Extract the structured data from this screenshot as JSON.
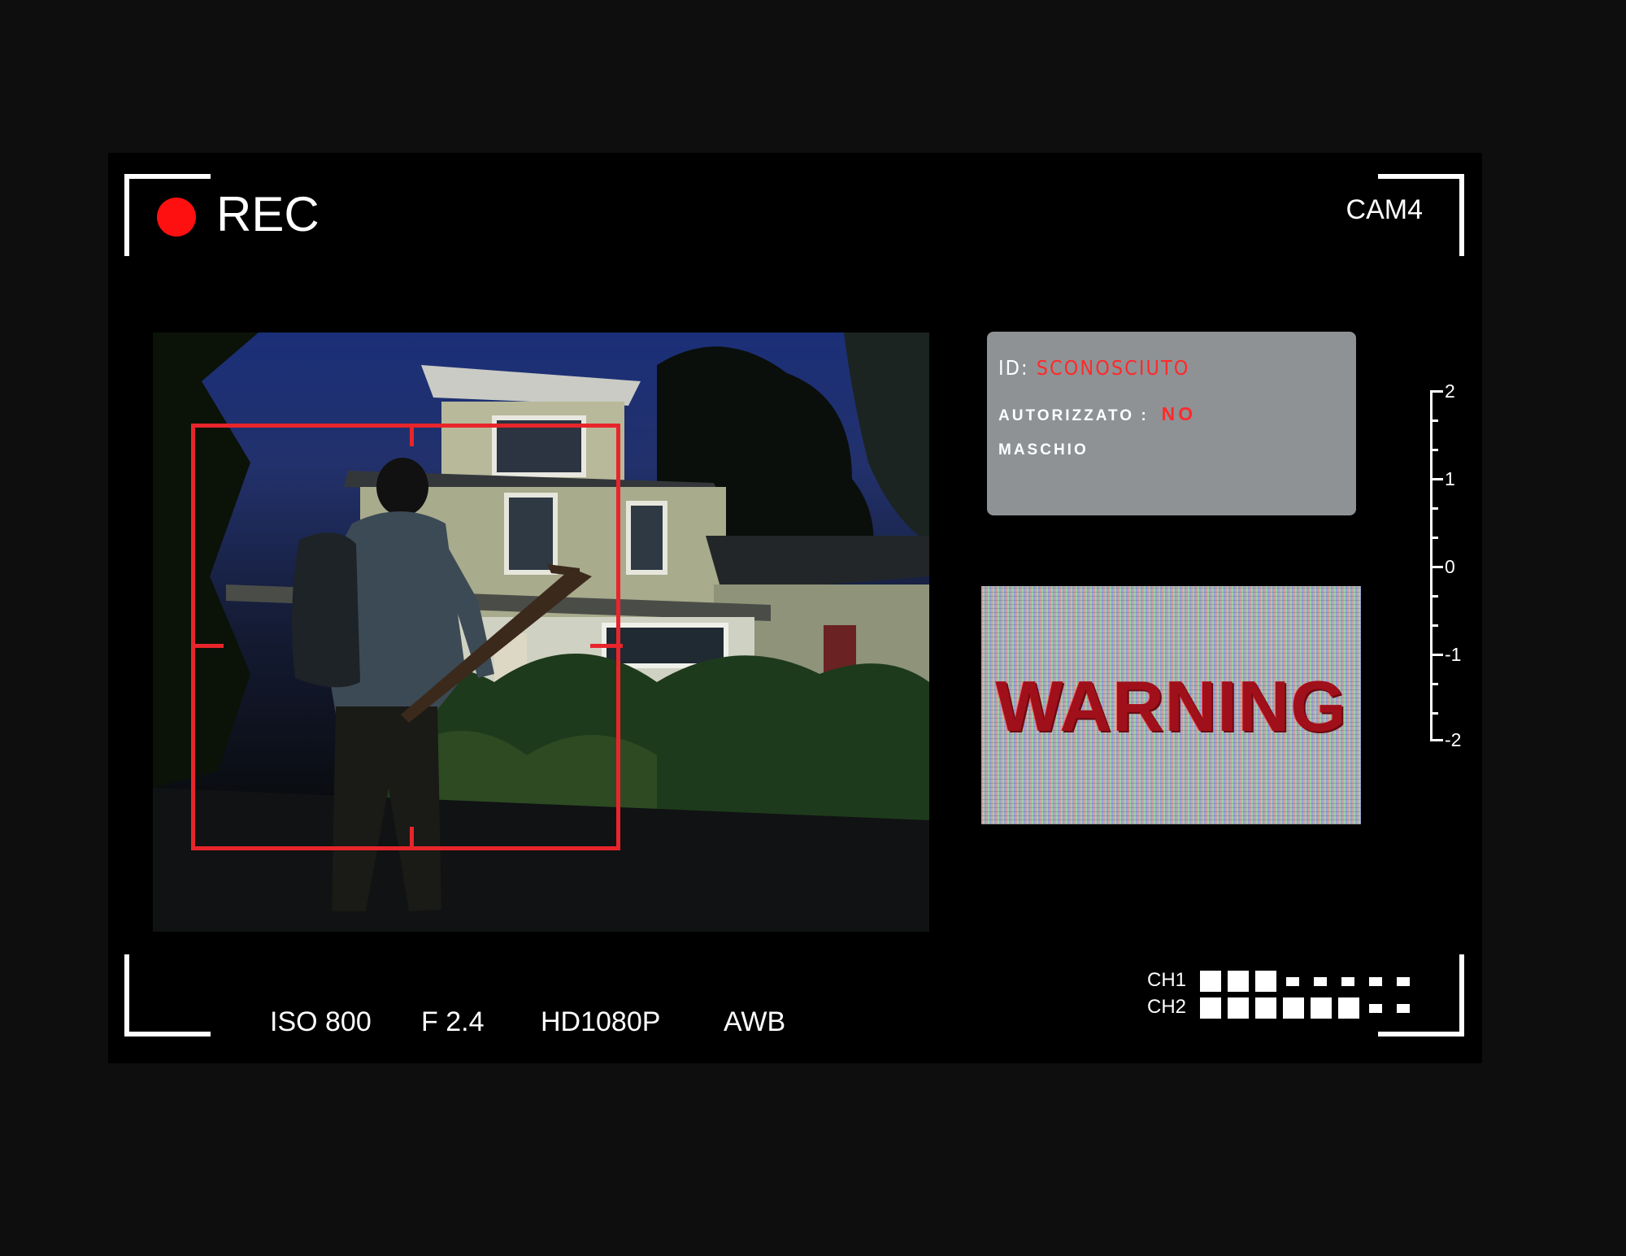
{
  "hud": {
    "rec_label": "REC",
    "camera_label": "CAM4",
    "rec_color": "#ff1010",
    "accent_color": "#e8252b"
  },
  "subject_card": {
    "id_label": "ID:",
    "id_value": "SCONOSCIUTO",
    "authorized_label": "AUTORIZZATO :",
    "authorized_value": "NO",
    "gender": "MASCHIO"
  },
  "warning": {
    "text": "WARNING"
  },
  "scale": {
    "labels": [
      "2",
      "1",
      "0",
      "-1",
      "-2"
    ]
  },
  "camera_settings": {
    "iso": "ISO 800",
    "aperture": "F 2.4",
    "resolution": "HD1080P",
    "white_balance": "AWB"
  },
  "channels": [
    {
      "label": "CH1",
      "level": 3,
      "max": 8
    },
    {
      "label": "CH2",
      "level": 6,
      "max": 8
    }
  ],
  "icons": [
    "record-dot-icon",
    "corner-bracket-icon"
  ]
}
